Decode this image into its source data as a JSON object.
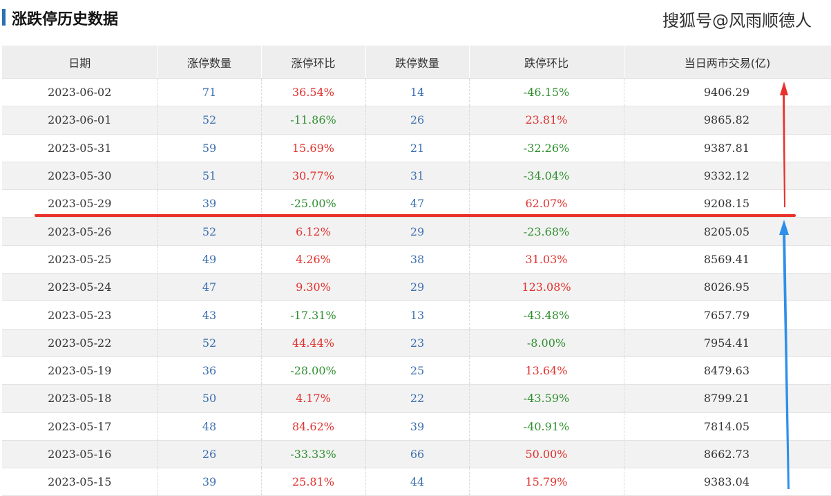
{
  "header": {
    "title": "涨跌停历史数据",
    "watermark": "搜狐号@风雨顺德人"
  },
  "table": {
    "columns": [
      "日期",
      "涨停数量",
      "涨停环比",
      "跌停数量",
      "跌停环比",
      "当日两市交易(亿)"
    ],
    "rows": [
      [
        "2023-06-02",
        "71",
        "36.54%",
        "14",
        "-46.15%",
        "9406.29"
      ],
      [
        "2023-06-01",
        "52",
        "-11.86%",
        "26",
        "23.81%",
        "9865.82"
      ],
      [
        "2023-05-31",
        "59",
        "15.69%",
        "21",
        "-32.26%",
        "9387.81"
      ],
      [
        "2023-05-30",
        "51",
        "30.77%",
        "31",
        "-34.04%",
        "9332.12"
      ],
      [
        "2023-05-29",
        "39",
        "-25.00%",
        "47",
        "62.07%",
        "9208.15"
      ],
      [
        "2023-05-26",
        "52",
        "6.12%",
        "29",
        "-23.68%",
        "8205.05"
      ],
      [
        "2023-05-25",
        "49",
        "4.26%",
        "38",
        "31.03%",
        "8569.41"
      ],
      [
        "2023-05-24",
        "47",
        "9.30%",
        "29",
        "123.08%",
        "8026.95"
      ],
      [
        "2023-05-23",
        "43",
        "-17.31%",
        "13",
        "-43.48%",
        "7657.79"
      ],
      [
        "2023-05-22",
        "52",
        "44.44%",
        "23",
        "-8.00%",
        "7954.41"
      ],
      [
        "2023-05-19",
        "36",
        "-28.00%",
        "25",
        "13.64%",
        "8479.63"
      ],
      [
        "2023-05-18",
        "50",
        "4.17%",
        "22",
        "-43.59%",
        "8799.21"
      ],
      [
        "2023-05-17",
        "48",
        "84.62%",
        "39",
        "-40.91%",
        "7814.05"
      ],
      [
        "2023-05-16",
        "26",
        "-33.33%",
        "66",
        "50.00%",
        "8662.73"
      ],
      [
        "2023-05-15",
        "39",
        "25.81%",
        "44",
        "15.79%",
        "9383.04"
      ]
    ]
  },
  "colors": {
    "positive": "#e0302c",
    "negative": "#2f8f2f",
    "count": "#3b6fb0",
    "accent": "#2b6fb6",
    "annotation_red": "#e8312a",
    "annotation_blue": "#2f8fe8"
  },
  "annotations": {
    "red_arrow": "arrow-up",
    "blue_arrow": "arrow-up",
    "divider_line": "horizontal-line"
  }
}
